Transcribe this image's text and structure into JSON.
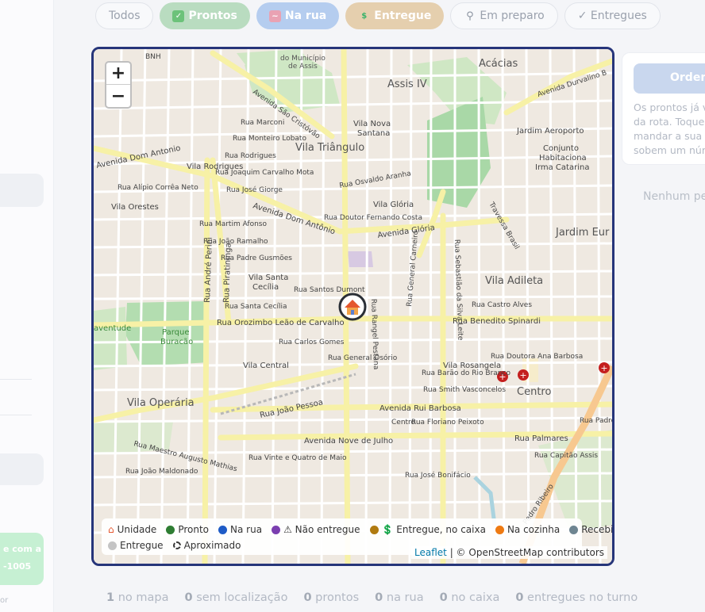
{
  "filters": [
    {
      "label": "Todos",
      "icon": "none"
    },
    {
      "label": "Prontos",
      "icon": "check-box-icon",
      "color": "#4caf50"
    },
    {
      "label": "Na rua",
      "icon": "scooter-icon",
      "color": "#e88aa0"
    },
    {
      "label": "Entregue",
      "icon": "dollar-icon",
      "color": "#3bb36b"
    },
    {
      "label": "Em preparo",
      "icon": "search-icon"
    },
    {
      "label": "✓ Entregues",
      "icon": "none"
    }
  ],
  "map": {
    "zoom_in": "+",
    "zoom_out": "−",
    "labels": {
      "assis_iv": "Assis IV",
      "vila_triangulo": "Vila Triângulo",
      "vila_nova_santana": [
        "Vila Nova",
        "Santana"
      ],
      "vila_orestes": "Vila Orestes",
      "vila_rodrigues": "Vila Rodrigues",
      "vila_gloria": "Vila Glória",
      "vila_santa_cecilia": [
        "Vila Santa",
        "Cecília"
      ],
      "vila_adileta": "Vila Adileta",
      "vila_central": "Vila Central",
      "vila_rosangela": "Vila Rosangela",
      "centro": "Centro",
      "vila_operaria": "Vila Operária",
      "jardim_aeroporto": "Jardim Aeroporto",
      "conjunto_habitacional": [
        "Conjunto",
        "Habitaciona",
        "Irma Catarina"
      ],
      "jardim_eur": "Jardim Eur",
      "acacias": "Acácias",
      "parque_buracao": [
        "Parque",
        "Buracão"
      ],
      "aventude": "aventude",
      "municipio": "do Município",
      "de_assis": "de Assis",
      "bnh": "BNH",
      "av_dom_antonio": "Avenida Dom Antonio",
      "av_dom_antonio_2": "Avenida Dom Antônio",
      "av_gloria": "Avenida Glória",
      "av_sao_cristovao": "Avenida São Cristóvão",
      "av_rui_barbosa": "Avenida Rui Barbosa",
      "av_nove_julho": "Avenida Nove de Julho",
      "av_durvalino": "Avenida Durvalino B",
      "rua_orozimbo": "Rua Orozimbo Leão de Carvalho",
      "rua_benedito": "Rua Benedito Spinardi",
      "rua_joao_pessoa": "Rua João Pessoa",
      "rua_santos_dumont": "Rua Santos Dumont",
      "rua_santa_cecilia": "Rua Santa Cecília",
      "rua_carlos_gomes": "Rua Carlos Gomes",
      "rua_general_osorio": "Rua General Osório",
      "rua_barao": "Rua Barão do Rio Branco",
      "rua_smith": "Rua Smith Vasconcelos",
      "rua_floriano": "Rua Floriano Peixoto",
      "rua_palmares": "Rua Palmares",
      "rua_capitao_assis": "Rua Capitão Assis",
      "rua_jose_bonifacio": "Rua José Bonifácio",
      "rua_vinte_quatro": "Rua Vinte e Quatro de Maio",
      "rua_maestro": "Rua Maestro Augusto Mathias",
      "rua_joao_maldonado": "Rua João Maldonado",
      "rua_doutora_ana": "Rua Doutora Ana Barbosa",
      "rua_castro_alves": "Rua Castro Alves",
      "rua_doutor_fernando": "Rua Doutor Fernando Costa",
      "rua_osvaldo_aranha": "Rua Osvaldo Aranha",
      "rua_monteiro_lobato": "Rua Monteiro Lobato",
      "rua_marconi": "Rua Marconi",
      "rua_rodrigues": "Rua Rodrigues",
      "rua_joaquim": "Rua Joaquim Carvalho Mota",
      "rua_jose_giorge": "Rua José Giorge",
      "rua_martim": "Rua Martim Afonso",
      "rua_joao_ramalho": "Rua João Ramalho",
      "rua_padre_gusmoes": "Rua Padre Gusmões",
      "rua_alipio": "Rua Alípio Corrêa Neto",
      "rua_andre_perini": "Rua André Perini",
      "rua_piratininga": "Rua Piratininga",
      "rua_rangel": "Rua Rangel Pestana",
      "rua_general_carneiro": "Rua General Carneiro",
      "rua_sebastiao": "Rua Sebastião da Silva Leite",
      "rua_padre_d": "Rua Padre D",
      "rua_pedro_ribeiro": "Pedro Ribeiro",
      "rua_travessa": "Travessa Brasil"
    },
    "home_marker_icon": "house-icon",
    "hospital_icon": "hospital-cross-icon"
  },
  "legend": {
    "row1": [
      {
        "label": "Unidade",
        "icon": "house-icon"
      },
      {
        "label": "Pronto",
        "color": "#2e7d32"
      },
      {
        "label": "Na rua",
        "color": "#1e5bc6"
      },
      {
        "label": "⚠ Não entregue",
        "color": "#7b3fb0"
      },
      {
        "label": "💲 Entregue, no caixa",
        "color": "#b07a10"
      },
      {
        "label": "Na cozinha",
        "color": "#ee7a12"
      },
      {
        "label": "Recebido",
        "color": "#6e8591"
      }
    ],
    "row2": [
      {
        "label": "Entregue",
        "color": "#c4c4c4"
      },
      {
        "label": "Aproximado",
        "icon": "dashed-circle-icon"
      }
    ]
  },
  "attribution": {
    "leaflet": "Leaflet",
    "rest": "| © OpenStreetMap contributors"
  },
  "right_panel": {
    "button": "Ordem",
    "lines": [
      "Os prontos já v",
      "da rota. Toque",
      "mandar a sua",
      "sobem um núm"
    ]
  },
  "empty_message": "Nenhum pe",
  "sidebar": {
    "green_lines": [
      "e com a",
      "-1005"
    ],
    "bottom": "or"
  },
  "stats": [
    {
      "num": "1",
      "label": "no mapa"
    },
    {
      "num": "0",
      "label": "sem localização"
    },
    {
      "num": "0",
      "label": "prontos"
    },
    {
      "num": "0",
      "label": "na rua"
    },
    {
      "num": "0",
      "label": "no caixa"
    },
    {
      "num": "0",
      "label": "entregues no turno"
    }
  ]
}
